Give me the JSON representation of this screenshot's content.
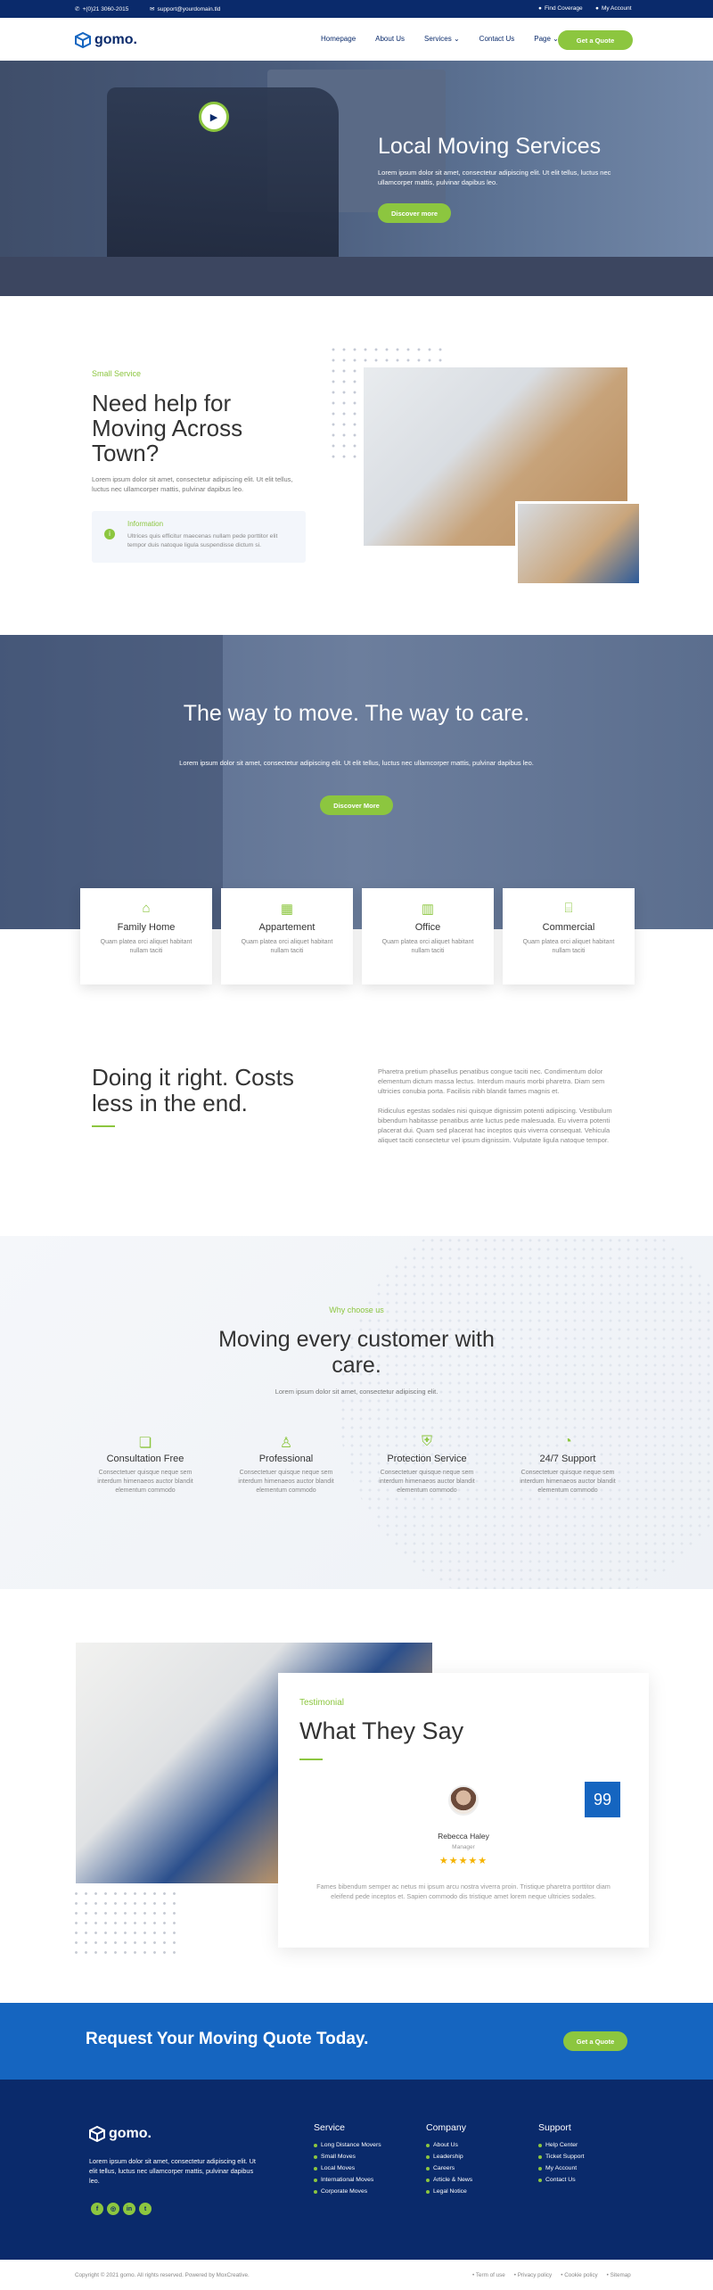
{
  "topbar": {
    "phone": "+(0)21 3060-2015",
    "email": "support@yourdomain.tld",
    "find_coverage": "Find Coverage",
    "my_account": "My Account"
  },
  "nav": {
    "logo": "gomo.",
    "links": [
      "Homepage",
      "About Us",
      "Services",
      "Contact Us",
      "Page"
    ],
    "cta": "Get a Quote"
  },
  "hero": {
    "title": "Local Moving Services",
    "text": "Lorem ipsum dolor sit amet, consectetur adipiscing elit. Ut elit tellus, luctus nec ullamcorper mattis, pulvinar dapibus leo.",
    "button": "Discover more"
  },
  "about": {
    "subtitle": "Small Service",
    "title": "Need help for Moving Across Town?",
    "text": "Lorem ipsum dolor sit amet, consectetur adipiscing elit. Ut elit tellus, luctus nec ullamcorper mattis, pulvinar dapibus leo.",
    "info_title": "Information",
    "info_text": "Ultrices quis efficitur maecenas nullam pede porttitor elit tempor duis natoque ligula suspendisse dictum si."
  },
  "banner": {
    "title": "The way to move. The way to care.",
    "text": "Lorem ipsum dolor sit amet, consectetur adipiscing elit. Ut elit tellus, luctus nec ullamcorper mattis, pulvinar dapibus leo.",
    "button": "Discover More"
  },
  "cards": [
    {
      "icon": "home-icon",
      "title": "Family Home",
      "text": "Quam platea orci aliquet habitant nullam taciti"
    },
    {
      "icon": "building-icon",
      "title": "Appartement",
      "text": "Quam platea orci aliquet habitant nullam taciti"
    },
    {
      "icon": "office-icon",
      "title": "Office",
      "text": "Quam platea orci aliquet habitant nullam taciti"
    },
    {
      "icon": "store-icon",
      "title": "Commercial",
      "text": "Quam platea orci aliquet habitant nullam taciti"
    }
  ],
  "costs": {
    "title": "Doing it right. Costs less in the end.",
    "p1": "Pharetra pretium phasellus penatibus congue taciti nec. Condimentum dolor elementum dictum massa lectus. Interdum mauris morbi pharetra. Diam sem ultricies conubia porta. Facilisis nibh blandit fames magnis et.",
    "p2": "Ridiculus egestas sodales nisi quisque dignissim potenti adipiscing. Vestibulum bibendum habitasse penatibus ante luctus pede malesuada. Eu viverra potenti placerat dui. Quam sed placerat hac inceptos quis viverra consequat. Vehicula aliquet taciti consectetur vel ipsum dignissim. Vulputate ligula natoque tempor."
  },
  "why": {
    "subtitle": "Why choose us",
    "title": "Moving every customer with care.",
    "text": "Lorem ipsum dolor sit amet, consectetur adipiscing elit.",
    "features": [
      {
        "icon": "chat-icon",
        "title": "Consultation Free",
        "text": "Consectetuer quisque neque sem interdum himenaeos auctor blandit elementum commodo"
      },
      {
        "icon": "people-icon",
        "title": "Professional",
        "text": "Consectetuer quisque neque sem interdum himenaeos auctor blandit elementum commodo"
      },
      {
        "icon": "shield-icon",
        "title": "Protection Service",
        "text": "Consectetuer quisque neque sem interdum himenaeos auctor blandit elementum commodo"
      },
      {
        "icon": "support-icon",
        "title": "24/7 Support",
        "text": "Consectetuer quisque neque sem interdum himenaeos auctor blandit elementum commodo"
      }
    ]
  },
  "testimonial": {
    "subtitle": "Testimonial",
    "title": "What They Say",
    "quote_mark": "99",
    "name": "Rebecca Haley",
    "role": "Manager",
    "stars": "★★★★★",
    "text": "Fames bibendum semper ac netus mi ipsum arcu nostra viverra proin. Tristique pharetra porttitor diam eleifend pede inceptos et. Sapien commodo dis tristique amet lorem neque ultricies sodales."
  },
  "cta": {
    "title": "Request Your Moving Quote Today.",
    "button": "Get a Quote"
  },
  "footer": {
    "logo": "gomo.",
    "text": "Lorem ipsum dolor sit amet, consectetur adipiscing elit. Ut elit tellus, luctus nec ullamcorper mattis, pulvinar dapibus leo.",
    "service_title": "Service",
    "service": [
      "Long Distance Movers",
      "Small Moves",
      "Local Moves",
      "International Moves",
      "Corporate Moves"
    ],
    "company_title": "Company",
    "company": [
      "About Us",
      "Leadership",
      "Careers",
      "Article & News",
      "Legal Notice"
    ],
    "support_title": "Support",
    "support": [
      "Help Center",
      "Ticket Support",
      "My Account",
      "Contact Us"
    ],
    "copyright": "Copyright © 2021 gomo. All rights reserved. Powered by MoxCreative.",
    "bottom_links": [
      "Term of use",
      "Privacy policy",
      "Cookie policy",
      "Sitemap"
    ]
  },
  "colors": {
    "primary": "#0a2a6b",
    "accent": "#8cc63f",
    "blue": "#1565c0"
  }
}
